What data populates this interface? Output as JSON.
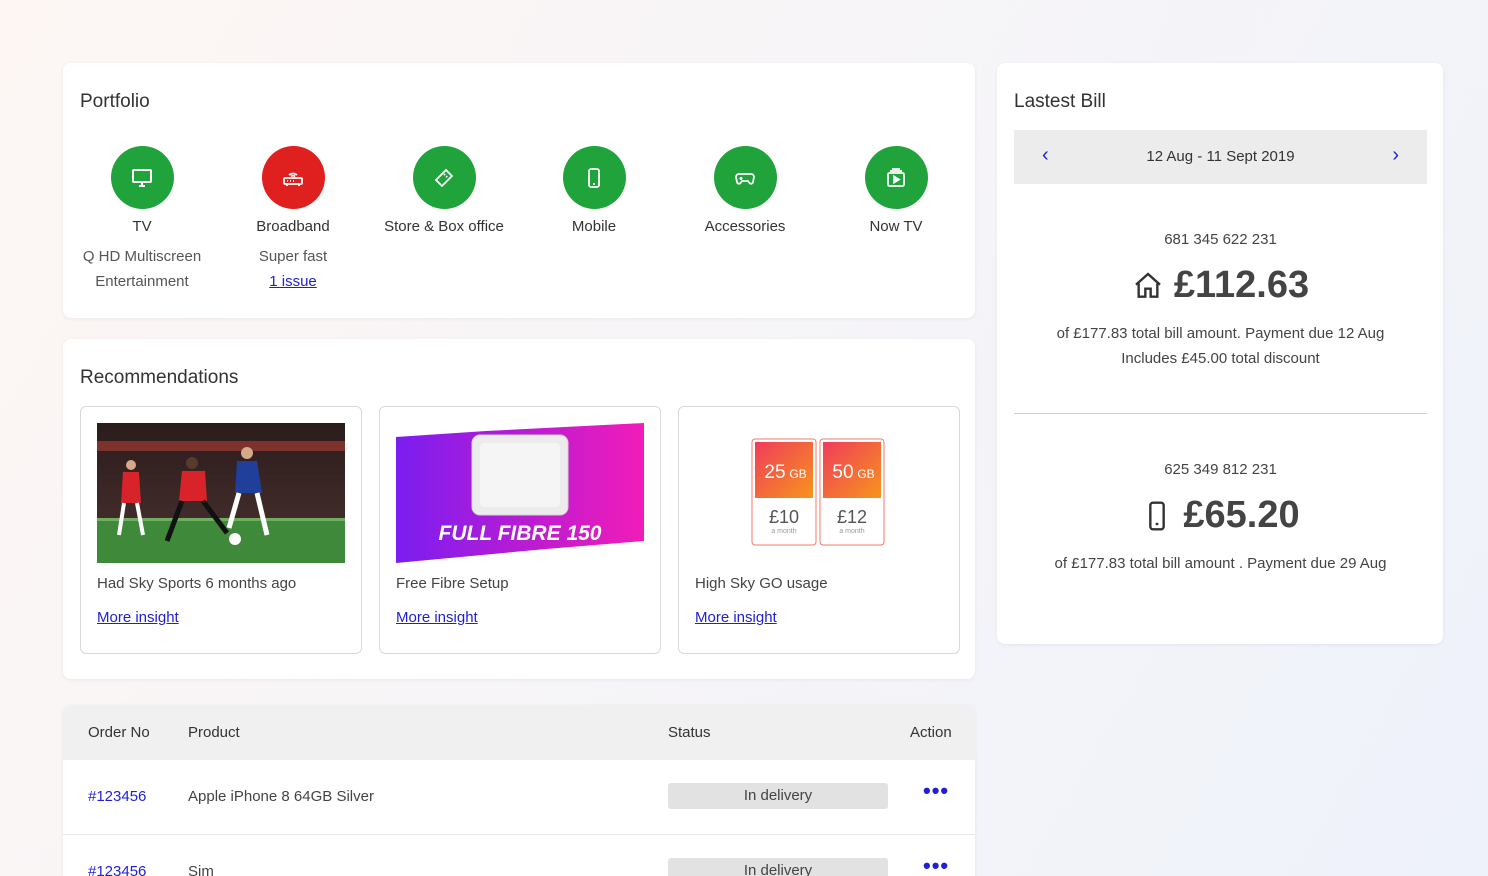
{
  "portfolio": {
    "title": "Portfolio",
    "items": [
      {
        "name": "TV",
        "sub1": "Q HD Multiscreen",
        "sub2": "Entertainment",
        "link": "",
        "icon": "tv-icon",
        "color": "#1fa33a"
      },
      {
        "name": "Broadband",
        "sub1": "Super fast",
        "sub2": "",
        "link": "1 issue",
        "icon": "router-icon",
        "color": "#e0201f"
      },
      {
        "name": "Store & Box office",
        "sub1": "",
        "sub2": "",
        "link": "",
        "icon": "ticket-icon",
        "color": "#1fa33a"
      },
      {
        "name": "Mobile",
        "sub1": "",
        "sub2": "",
        "link": "",
        "icon": "mobile-icon",
        "color": "#1fa33a"
      },
      {
        "name": "Accessories",
        "sub1": "",
        "sub2": "",
        "link": "",
        "icon": "gamepad-icon",
        "color": "#1fa33a"
      },
      {
        "name": "Now TV",
        "sub1": "",
        "sub2": "",
        "link": "",
        "icon": "now-tv-icon",
        "color": "#1fa33a"
      }
    ]
  },
  "recommendations": {
    "title": "Recommendations",
    "items": [
      {
        "text": "Had Sky Sports 6 months ago",
        "link": "More insight"
      },
      {
        "text": "Free Fibre Setup",
        "link": "More insight",
        "banner": "FULL FIBRE 150"
      },
      {
        "text": "High Sky GO usage",
        "link": "More insight",
        "plans": [
          {
            "data": "25",
            "unit": "GB",
            "price": "£10",
            "period": "a month"
          },
          {
            "data": "50",
            "unit": "GB",
            "price": "£12",
            "period": "a month"
          }
        ]
      }
    ]
  },
  "orders": {
    "headers": {
      "order_no": "Order No",
      "product": "Product",
      "status": "Status",
      "action": "Action"
    },
    "rows": [
      {
        "order_no": "#123456",
        "product": "Apple iPhone 8 64GB Silver",
        "status": "In delivery",
        "action": "•••"
      },
      {
        "order_no": "#123456",
        "product": "Sim",
        "status": "In delivery",
        "action": "•••"
      }
    ]
  },
  "bill": {
    "title": "Lastest Bill",
    "period": "12 Aug - 11 Sept 2019",
    "prev_arrow": "‹",
    "next_arrow": "›",
    "accounts": [
      {
        "number": "681 345 622 231",
        "amount": "£112.63",
        "icon": "home-icon",
        "desc1": "of £177.83 total bill amount. Payment due 12 Aug",
        "desc2": "Includes £45.00 total discount"
      },
      {
        "number": "625 349 812 231",
        "amount": "£65.20",
        "icon": "mobile-icon",
        "desc1": "of £177.83 total bill amount . Payment due 29 Aug",
        "desc2": ""
      }
    ]
  },
  "colors": {
    "link": "#1f1fd6",
    "green": "#1fa33a",
    "red": "#e0201f",
    "magenta": "#e91ec0",
    "purple": "#7a1df0"
  }
}
